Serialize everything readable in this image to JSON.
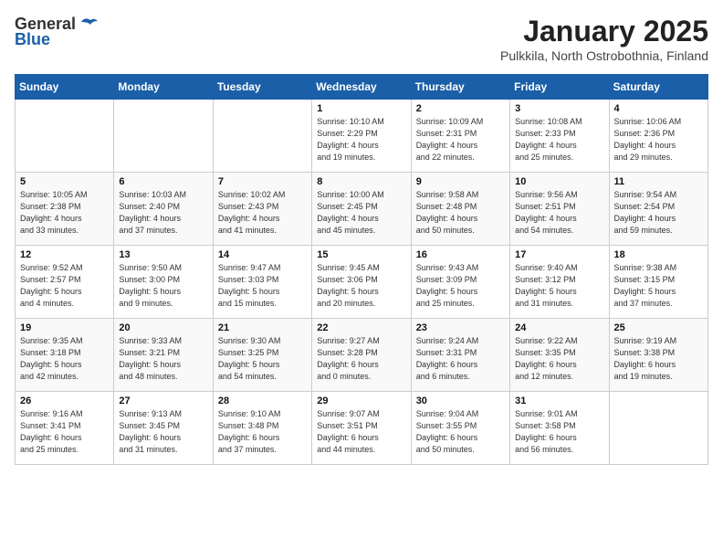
{
  "logo": {
    "general": "General",
    "blue": "Blue"
  },
  "title": "January 2025",
  "subtitle": "Pulkkila, North Ostrobothnia, Finland",
  "days_header": [
    "Sunday",
    "Monday",
    "Tuesday",
    "Wednesday",
    "Thursday",
    "Friday",
    "Saturday"
  ],
  "weeks": [
    [
      {
        "day": "",
        "info": ""
      },
      {
        "day": "",
        "info": ""
      },
      {
        "day": "",
        "info": ""
      },
      {
        "day": "1",
        "info": "Sunrise: 10:10 AM\nSunset: 2:29 PM\nDaylight: 4 hours\nand 19 minutes."
      },
      {
        "day": "2",
        "info": "Sunrise: 10:09 AM\nSunset: 2:31 PM\nDaylight: 4 hours\nand 22 minutes."
      },
      {
        "day": "3",
        "info": "Sunrise: 10:08 AM\nSunset: 2:33 PM\nDaylight: 4 hours\nand 25 minutes."
      },
      {
        "day": "4",
        "info": "Sunrise: 10:06 AM\nSunset: 2:36 PM\nDaylight: 4 hours\nand 29 minutes."
      }
    ],
    [
      {
        "day": "5",
        "info": "Sunrise: 10:05 AM\nSunset: 2:38 PM\nDaylight: 4 hours\nand 33 minutes."
      },
      {
        "day": "6",
        "info": "Sunrise: 10:03 AM\nSunset: 2:40 PM\nDaylight: 4 hours\nand 37 minutes."
      },
      {
        "day": "7",
        "info": "Sunrise: 10:02 AM\nSunset: 2:43 PM\nDaylight: 4 hours\nand 41 minutes."
      },
      {
        "day": "8",
        "info": "Sunrise: 10:00 AM\nSunset: 2:45 PM\nDaylight: 4 hours\nand 45 minutes."
      },
      {
        "day": "9",
        "info": "Sunrise: 9:58 AM\nSunset: 2:48 PM\nDaylight: 4 hours\nand 50 minutes."
      },
      {
        "day": "10",
        "info": "Sunrise: 9:56 AM\nSunset: 2:51 PM\nDaylight: 4 hours\nand 54 minutes."
      },
      {
        "day": "11",
        "info": "Sunrise: 9:54 AM\nSunset: 2:54 PM\nDaylight: 4 hours\nand 59 minutes."
      }
    ],
    [
      {
        "day": "12",
        "info": "Sunrise: 9:52 AM\nSunset: 2:57 PM\nDaylight: 5 hours\nand 4 minutes."
      },
      {
        "day": "13",
        "info": "Sunrise: 9:50 AM\nSunset: 3:00 PM\nDaylight: 5 hours\nand 9 minutes."
      },
      {
        "day": "14",
        "info": "Sunrise: 9:47 AM\nSunset: 3:03 PM\nDaylight: 5 hours\nand 15 minutes."
      },
      {
        "day": "15",
        "info": "Sunrise: 9:45 AM\nSunset: 3:06 PM\nDaylight: 5 hours\nand 20 minutes."
      },
      {
        "day": "16",
        "info": "Sunrise: 9:43 AM\nSunset: 3:09 PM\nDaylight: 5 hours\nand 25 minutes."
      },
      {
        "day": "17",
        "info": "Sunrise: 9:40 AM\nSunset: 3:12 PM\nDaylight: 5 hours\nand 31 minutes."
      },
      {
        "day": "18",
        "info": "Sunrise: 9:38 AM\nSunset: 3:15 PM\nDaylight: 5 hours\nand 37 minutes."
      }
    ],
    [
      {
        "day": "19",
        "info": "Sunrise: 9:35 AM\nSunset: 3:18 PM\nDaylight: 5 hours\nand 42 minutes."
      },
      {
        "day": "20",
        "info": "Sunrise: 9:33 AM\nSunset: 3:21 PM\nDaylight: 5 hours\nand 48 minutes."
      },
      {
        "day": "21",
        "info": "Sunrise: 9:30 AM\nSunset: 3:25 PM\nDaylight: 5 hours\nand 54 minutes."
      },
      {
        "day": "22",
        "info": "Sunrise: 9:27 AM\nSunset: 3:28 PM\nDaylight: 6 hours\nand 0 minutes."
      },
      {
        "day": "23",
        "info": "Sunrise: 9:24 AM\nSunset: 3:31 PM\nDaylight: 6 hours\nand 6 minutes."
      },
      {
        "day": "24",
        "info": "Sunrise: 9:22 AM\nSunset: 3:35 PM\nDaylight: 6 hours\nand 12 minutes."
      },
      {
        "day": "25",
        "info": "Sunrise: 9:19 AM\nSunset: 3:38 PM\nDaylight: 6 hours\nand 19 minutes."
      }
    ],
    [
      {
        "day": "26",
        "info": "Sunrise: 9:16 AM\nSunset: 3:41 PM\nDaylight: 6 hours\nand 25 minutes."
      },
      {
        "day": "27",
        "info": "Sunrise: 9:13 AM\nSunset: 3:45 PM\nDaylight: 6 hours\nand 31 minutes."
      },
      {
        "day": "28",
        "info": "Sunrise: 9:10 AM\nSunset: 3:48 PM\nDaylight: 6 hours\nand 37 minutes."
      },
      {
        "day": "29",
        "info": "Sunrise: 9:07 AM\nSunset: 3:51 PM\nDaylight: 6 hours\nand 44 minutes."
      },
      {
        "day": "30",
        "info": "Sunrise: 9:04 AM\nSunset: 3:55 PM\nDaylight: 6 hours\nand 50 minutes."
      },
      {
        "day": "31",
        "info": "Sunrise: 9:01 AM\nSunset: 3:58 PM\nDaylight: 6 hours\nand 56 minutes."
      },
      {
        "day": "",
        "info": ""
      }
    ]
  ]
}
